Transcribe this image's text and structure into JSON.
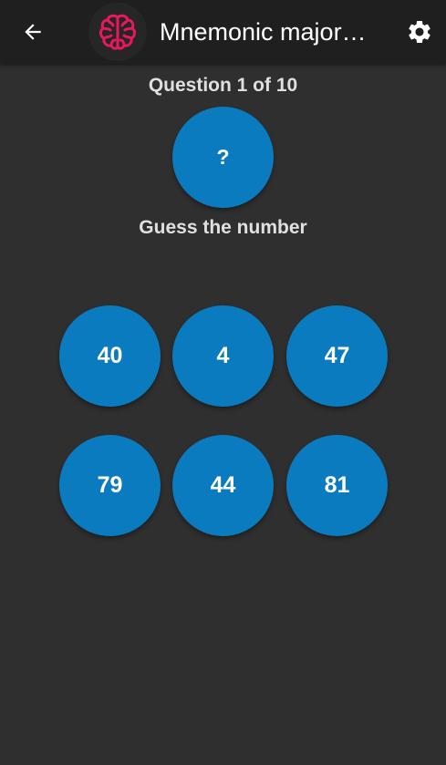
{
  "appbar": {
    "back_icon": "arrow-left-icon",
    "logo_icon": "brain-icon",
    "logo_color": "#e8185f",
    "title": "Mnemonic major…",
    "settings_icon": "gear-icon"
  },
  "quiz": {
    "question_label": "Question 1 of 10",
    "mystery_symbol": "?",
    "prompt": "Guess the number",
    "options": [
      "40",
      "4",
      "47",
      "79",
      "44",
      "81"
    ]
  },
  "colors": {
    "background": "#2f2f2f",
    "appbar": "#1f1f1f",
    "circle": "#0b7bc0",
    "text": "#e0e0e0"
  }
}
